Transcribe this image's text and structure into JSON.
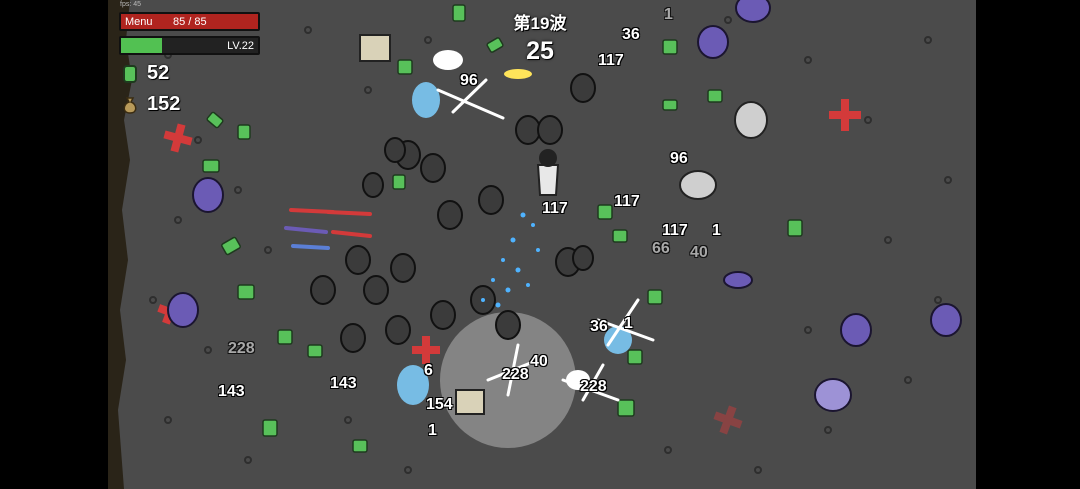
{
  "hud": {
    "fps_label": "fps: 45",
    "menu_label": "Menu",
    "hp_text": "85 / 85",
    "hp_fraction": 1.0,
    "level_text": "LV.22",
    "xp_fraction": 0.3,
    "gems": "52",
    "materials": "152"
  },
  "wave": {
    "title": "第19波",
    "timer": "25"
  },
  "damage_numbers": [
    "96",
    "36",
    "117",
    "96",
    "117",
    "117",
    "117",
    "1",
    "66",
    "40",
    "36",
    "1",
    "228",
    "40",
    "228",
    "228",
    "143",
    "143",
    "154",
    "1",
    "6",
    "1"
  ],
  "colors": {
    "arena": "#4b4b4b",
    "hp": "#b0241f",
    "xp": "#52c152",
    "gem": "#58c15a",
    "enemy_purple": "#6b5bb5"
  }
}
